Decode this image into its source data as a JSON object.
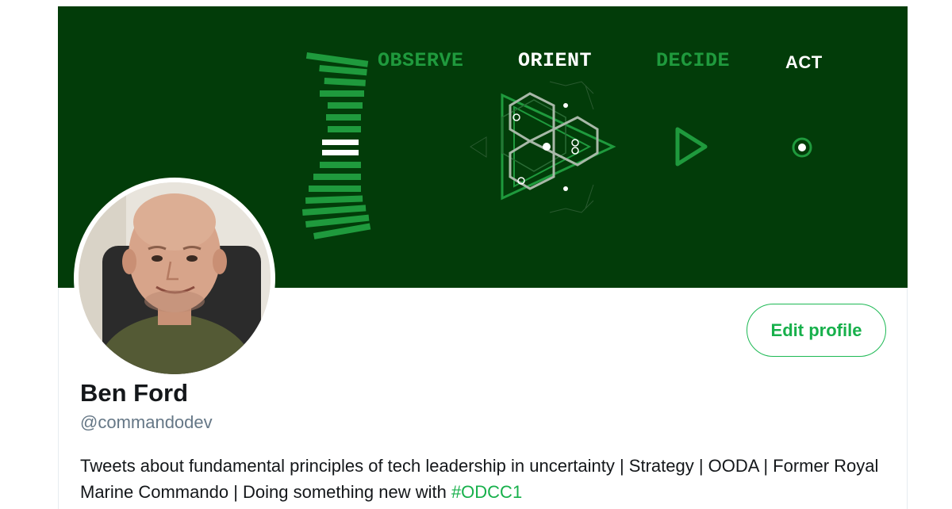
{
  "banner": {
    "stages": [
      {
        "label": "OBSERVE"
      },
      {
        "label": "ORIENT"
      },
      {
        "label": "DECIDE"
      },
      {
        "label": "ACT"
      }
    ],
    "colors": {
      "background": "#023c09",
      "accent": "#1f9a3d",
      "highlight": "#ffffff"
    }
  },
  "profile": {
    "name": "Ben Ford",
    "handle": "@commandodev",
    "bio_text": "Tweets about fundamental principles of tech leadership in uncertainty | Strategy | OODA | Former Royal Marine Commando | Doing something new with ",
    "bio_hashtag": "#ODCC1",
    "edit_button_label": "Edit profile",
    "accent_color": "#17b04b"
  }
}
